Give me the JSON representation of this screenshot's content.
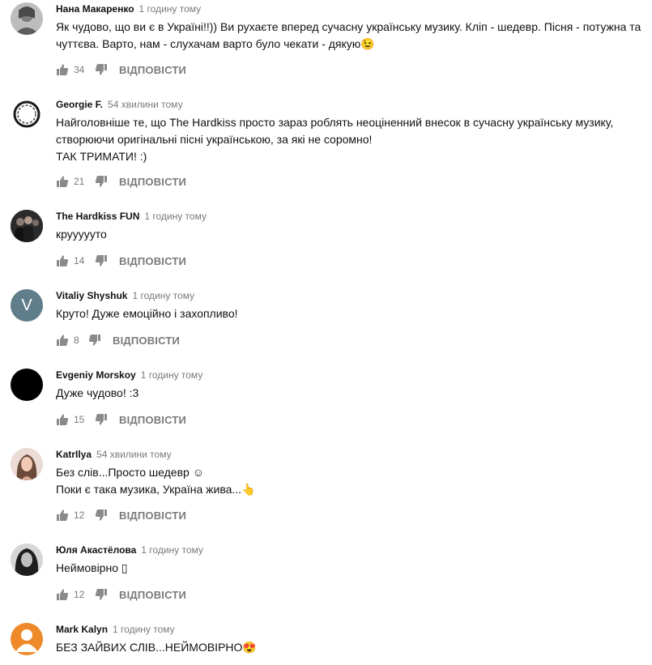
{
  "reply_label": "ВІДПОВІСТИ",
  "comments": [
    {
      "author": "Нана Макаренко",
      "time": "1 годину тому",
      "lines": [
        "Як чудово, що ви є в Україні!!)) Ви рухаєте вперед сучасну українську музику. Кліп - шедевр. Пісня - потужна та",
        "чуттєва. Варто, нам - слухачам варто було чекати - дякую😉"
      ],
      "likes": "34",
      "avatar": "photo-avatar-grey"
    },
    {
      "author": "Georgie F.",
      "time": "54 хвилини тому",
      "lines": [
        "Найголовніше те, що The Hardkiss просто зараз роблять неоціненний внесок в сучасну українську музику,",
        "створюючи оригінальні пісні українською, за які не соромно!",
        "ТАК ТРИМАТИ! :)"
      ],
      "likes": "21",
      "avatar": "ring-avatar"
    },
    {
      "author": "The Hardkiss FUN",
      "time": "1 годину тому",
      "lines": [
        "круууууто"
      ],
      "likes": "14",
      "avatar": "band-photo-avatar"
    },
    {
      "author": "Vitaliy Shyshuk",
      "time": "1 годину тому",
      "lines": [
        "Круто! Дуже емоційно і захопливо!"
      ],
      "likes": "8",
      "avatar": "letter-avatar",
      "avatar_letter": "V",
      "avatar_color": "#607d8b"
    },
    {
      "author": "Evgeniy Morskoy",
      "time": "1 годину тому",
      "lines": [
        "Дуже чудово! :3"
      ],
      "likes": "15",
      "avatar": "black-avatar"
    },
    {
      "author": "KatrIlya",
      "time": "54 хвилини тому",
      "lines": [
        "Без слів...Просто шедевр ☺",
        "Поки є така музика, Україна жива...👆"
      ],
      "likes": "12",
      "avatar": "portrait-avatar-girl"
    },
    {
      "author": "Юля Акастёлова",
      "time": "1 годину тому",
      "lines": [
        "Неймовірно ▯"
      ],
      "likes": "12",
      "avatar": "portrait-avatar-dark"
    },
    {
      "author": "Mark Kalyn",
      "time": "1 годину тому",
      "lines": [
        "БЕЗ ЗАЙВИХ СЛІВ...НЕЙМОВІРНО😍"
      ],
      "likes": "",
      "avatar": "default-user-avatar",
      "avatar_color": "#ef8a2a"
    }
  ]
}
